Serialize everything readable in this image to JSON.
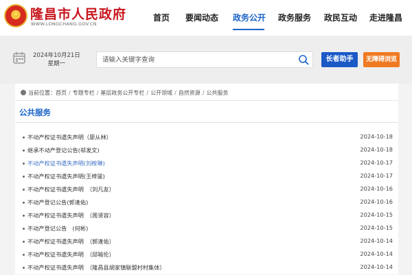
{
  "header": {
    "site_title": "隆昌市人民政府",
    "site_url": "WWW.LONGCHANG.GOV.CN",
    "nav": [
      {
        "label": "首页",
        "active": false
      },
      {
        "label": "要闻动态",
        "active": false
      },
      {
        "label": "政务公开",
        "active": true
      },
      {
        "label": "政务服务",
        "active": false
      },
      {
        "label": "政民互动",
        "active": false
      },
      {
        "label": "走进隆昌",
        "active": false
      }
    ]
  },
  "toolbar": {
    "date": "2024年10月21日",
    "weekday": "星期一",
    "search_placeholder": "请输入关键字查询",
    "elder_button": "长者助手",
    "access_button": "无障碍浏览"
  },
  "breadcrumb": {
    "prefix": "当前位置：",
    "items": [
      "首页",
      "专题专栏",
      "基层政务公开专栏",
      "公开领域",
      "自然资源",
      "公共服务"
    ]
  },
  "section": {
    "title": "公共服务"
  },
  "list": [
    {
      "title": "不动产权证书遗失声明（廖从林）",
      "date": "2024-10-18"
    },
    {
      "title": "继承不动产登记公告(邬发文)",
      "date": "2024-10-18"
    },
    {
      "title": "不动产权证书遗失声明(刘桉琳)",
      "date": "2024-10-17",
      "highlight": true
    },
    {
      "title": "不动产权证书遗失声明(王梓骏)",
      "date": "2024-10-17"
    },
    {
      "title": "不动产权证书遗失声明　（刘凡友）",
      "date": "2024-10-16"
    },
    {
      "title": "不动产登记公告(郭逢佑)",
      "date": "2024-10-16"
    },
    {
      "title": "不动产权证书遗失声明　（周贤容）",
      "date": "2024-10-15"
    },
    {
      "title": "不动产登记公告　(何彬)",
      "date": "2024-10-15"
    },
    {
      "title": "不动产权证书遗失声明　（郭逢佑）",
      "date": "2024-10-14"
    },
    {
      "title": "不动产权证书遗失声明　（邱喻伦）",
      "date": "2024-10-14"
    },
    {
      "title": "不动产权证书遗失声明　（隆昌县胡家镇联盟村村集体）",
      "date": "2024-10-14"
    }
  ]
}
